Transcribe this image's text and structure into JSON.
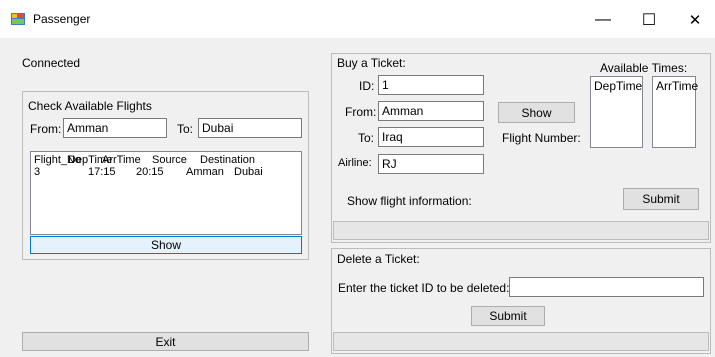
{
  "window": {
    "title": "Passenger",
    "minimize": "—",
    "maximize": "☐",
    "close": "✕"
  },
  "status": {
    "text": "Connected"
  },
  "check_flights": {
    "title": "Check Available Flights",
    "from_label": "From:",
    "from_value": "Amman",
    "to_label": "To:",
    "to_value": "Dubai",
    "columns": [
      "Flight_No",
      "DepTime",
      "ArrTime",
      "Source",
      "Destination"
    ],
    "rows": [
      [
        "3",
        "17:15",
        "20:15",
        "Amman",
        "Dubai"
      ]
    ],
    "show_label": "Show"
  },
  "exit_label": "Exit",
  "buy_ticket": {
    "title": "Buy a Ticket:",
    "id_label": "ID:",
    "id_value": "1",
    "from_label": "From:",
    "from_value": "Amman",
    "to_label": "To:",
    "to_value": "Iraq",
    "airline_label": "Airline:",
    "airline_value": "RJ",
    "show_label": "Show",
    "flight_number_label": "Flight Number:",
    "available_times_label": "Available Times:",
    "deptime_header": "DepTime",
    "arrtime_header": "ArrTime",
    "show_info_label": "Show flight information:",
    "submit_label": "Submit"
  },
  "delete_ticket": {
    "title": "Delete a Ticket:",
    "prompt": "Enter the ticket ID to be deleted:",
    "id_value": "",
    "submit_label": "Submit"
  }
}
